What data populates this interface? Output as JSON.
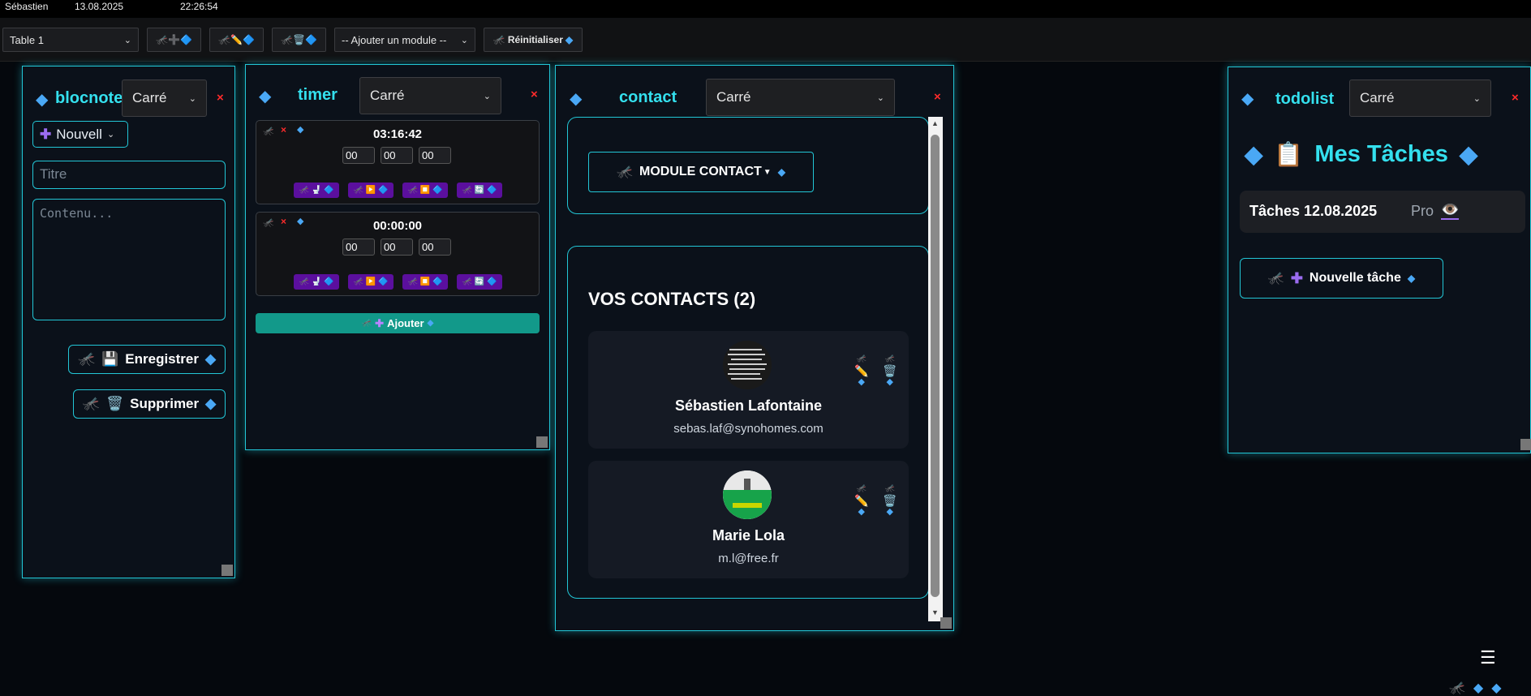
{
  "topbar": {
    "user": "Sébastien",
    "date": "13.08.2025",
    "time": "22:26:54",
    "icons": [
      "🧑‍💻",
      "⭐",
      "👨‍👩‍👦",
      "🔑",
      "📜",
      "🛠️"
    ]
  },
  "toolbar": {
    "table_select": "Table 1",
    "add_module_select": "-- Ajouter un module --",
    "reset_label": "Réinitialiser",
    "btn_add_icons": "🦟➕🔷",
    "btn_edit_icons": "🦟✏️🔷",
    "btn_delete_icons": "🦟🗑️🔷"
  },
  "bloc": {
    "title": "blocnote",
    "shape": "Carré",
    "close": "×",
    "new_select": "Nouvell",
    "title_placeholder": "Titre",
    "content_placeholder": "Contenu...",
    "save_label": "Enregistrer",
    "delete_label": "Supprimer"
  },
  "timer": {
    "title": "timer",
    "shape": "Carré",
    "close": "×",
    "timers": [
      {
        "time": "03:16:42",
        "h": "00",
        "m": "00",
        "s": "00"
      },
      {
        "time": "00:00:00",
        "h": "00",
        "m": "00",
        "s": "00"
      }
    ],
    "controls": [
      "🦟 🚽 🔷",
      "🦟 ▶️ 🔷",
      "🦟 ⏹️ 🔷",
      "🦟 🔄 🔷"
    ],
    "add_label": "Ajouter"
  },
  "contact": {
    "title": "contact",
    "shape": "Carré",
    "close": "×",
    "module_label": "MODULE CONTACT",
    "list_title": "VOS CONTACTS (2)",
    "contacts": [
      {
        "name": "Sébastien Lafontaine",
        "email": "sebas.laf@synohomes.com"
      },
      {
        "name": "Marie Lola",
        "email": "m.l@free.fr"
      }
    ]
  },
  "todo": {
    "title": "todolist",
    "shape": "Carré",
    "close": "×",
    "heading": "Mes Tâches",
    "heading_icon": "📋",
    "day_label": "Tâches 12.08.2025",
    "category": "Pro",
    "eye_icon": "👁️",
    "new_task_label": "Nouvelle tâche"
  },
  "corner": {
    "menu_icon": "☰"
  },
  "colors": {
    "accent": "#22c6d6",
    "title": "#34e0ee",
    "diamond": "#4aa8f5",
    "purple": "#5b0f9e",
    "teal": "#12998a",
    "close": "#ff2b2b"
  }
}
